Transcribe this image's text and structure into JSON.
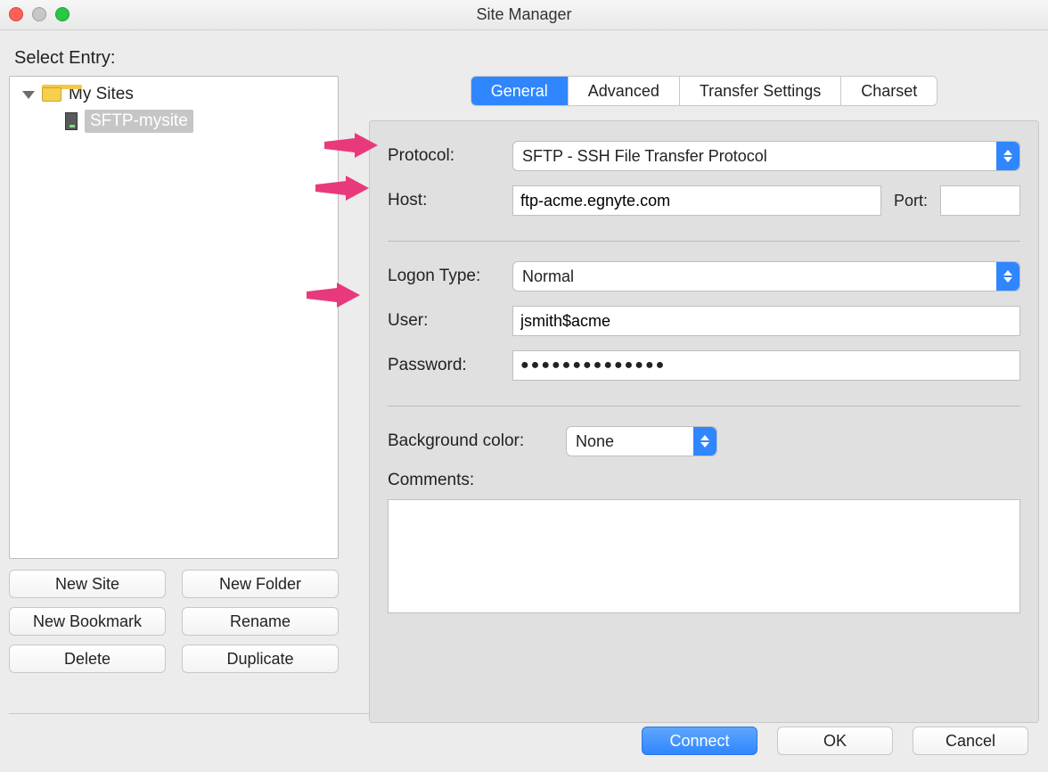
{
  "window": {
    "title": "Site Manager"
  },
  "sidebar": {
    "heading": "Select Entry:",
    "root_label": "My Sites",
    "selected_site": "SFTP-mysite"
  },
  "side_buttons": {
    "new_site": "New Site",
    "new_folder": "New Folder",
    "new_bookmark": "New Bookmark",
    "rename": "Rename",
    "delete": "Delete",
    "duplicate": "Duplicate"
  },
  "tabs": {
    "general": "General",
    "advanced": "Advanced",
    "transfer": "Transfer Settings",
    "charset": "Charset"
  },
  "form": {
    "protocol_label": "Protocol:",
    "protocol_value": "SFTP - SSH File Transfer Protocol",
    "host_label": "Host:",
    "host_value": "ftp-acme.egnyte.com",
    "port_label": "Port:",
    "port_value": "",
    "logon_type_label": "Logon Type:",
    "logon_type_value": "Normal",
    "user_label": "User:",
    "user_value": "jsmith$acme",
    "password_label": "Password:",
    "password_display": "●●●●●●●●●●●●●●",
    "bgcolor_label": "Background color:",
    "bgcolor_value": "None",
    "comments_label": "Comments:",
    "comments_value": ""
  },
  "footer": {
    "connect": "Connect",
    "ok": "OK",
    "cancel": "Cancel"
  },
  "annotations": {
    "arrow_color": "#e9397d"
  }
}
